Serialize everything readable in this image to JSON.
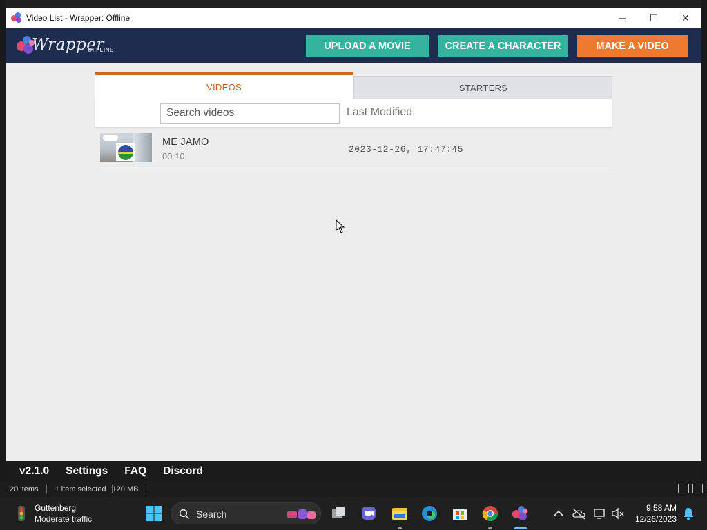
{
  "window": {
    "title": "Video List - Wrapper: Offline",
    "controls": {
      "minimize": "─",
      "maximize": "☐",
      "close": "✕"
    }
  },
  "header": {
    "logo_word": "Wrapper",
    "logo_suffix": "OFFLINE",
    "buttons": {
      "upload": "UPLOAD A MOVIE",
      "character": "CREATE A CHARACTER",
      "video": "MAKE A VIDEO"
    },
    "colors": {
      "bar": "#1e2c4f",
      "teal": "#35b39f",
      "orange": "#ee7a2e"
    }
  },
  "tabs": {
    "videos": "VIDEOS",
    "starters": "STARTERS",
    "active": "VIDEOS"
  },
  "toolbar": {
    "search_placeholder": "Search videos",
    "sort_label": "Last Modified"
  },
  "videos": [
    {
      "title": "ME JAMO",
      "duration": "00:10",
      "modified": "2023-12-26, 17:47:45"
    }
  ],
  "footer": {
    "version": "v2.1.0",
    "settings": "Settings",
    "faq": "FAQ",
    "discord": "Discord"
  },
  "explorer_status": {
    "items": "20 items",
    "selected": "1 item selected",
    "size": "120 MB"
  },
  "taskbar": {
    "weather_title": "Guttenberg",
    "weather_detail": "Moderate traffic",
    "search_label": "Search",
    "time": "9:58 AM",
    "date": "12/26/2023"
  }
}
